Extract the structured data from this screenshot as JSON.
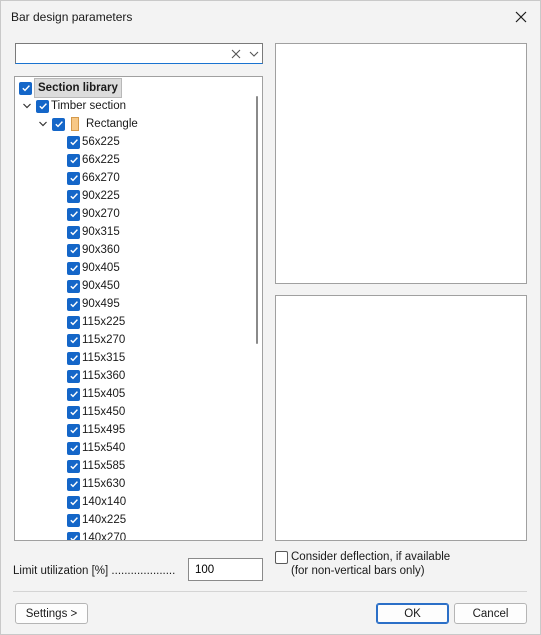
{
  "window": {
    "title": "Bar design parameters",
    "close_icon": "close-icon"
  },
  "search": {
    "value": "",
    "placeholder": ""
  },
  "tree": {
    "root": {
      "label": "Section library",
      "checked": true,
      "expanded": true
    },
    "group": {
      "label": "Timber section",
      "checked": true,
      "expanded": true
    },
    "shape": {
      "label": "Rectangle",
      "checked": true,
      "expanded": true,
      "icon": "rectangle-icon"
    },
    "items": [
      {
        "label": "56x225",
        "checked": true
      },
      {
        "label": "66x225",
        "checked": true
      },
      {
        "label": "66x270",
        "checked": true
      },
      {
        "label": "90x225",
        "checked": true
      },
      {
        "label": "90x270",
        "checked": true
      },
      {
        "label": "90x315",
        "checked": true
      },
      {
        "label": "90x360",
        "checked": true
      },
      {
        "label": "90x405",
        "checked": true
      },
      {
        "label": "90x450",
        "checked": true
      },
      {
        "label": "90x495",
        "checked": true
      },
      {
        "label": "115x225",
        "checked": true
      },
      {
        "label": "115x270",
        "checked": true
      },
      {
        "label": "115x315",
        "checked": true
      },
      {
        "label": "115x360",
        "checked": true
      },
      {
        "label": "115x405",
        "checked": true
      },
      {
        "label": "115x450",
        "checked": true
      },
      {
        "label": "115x495",
        "checked": true
      },
      {
        "label": "115x540",
        "checked": true
      },
      {
        "label": "115x585",
        "checked": true
      },
      {
        "label": "115x630",
        "checked": true
      },
      {
        "label": "140x140",
        "checked": true
      },
      {
        "label": "140x225",
        "checked": true
      },
      {
        "label": "140x270",
        "checked": true
      }
    ]
  },
  "limit": {
    "label": "Limit utilization [%] ....................",
    "value": "100"
  },
  "deflection": {
    "line1": "Consider deflection, if available",
    "line2": "(for non-vertical bars only)",
    "checked": false
  },
  "buttons": {
    "settings": "Settings >",
    "ok": "OK",
    "cancel": "Cancel"
  },
  "colors": {
    "accent": "#1466c8",
    "rectangle_fill": "#f7c886"
  }
}
